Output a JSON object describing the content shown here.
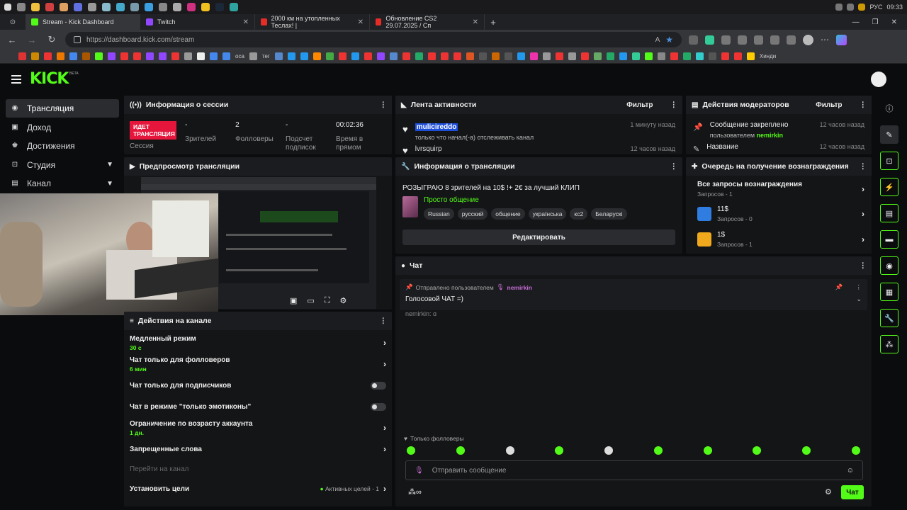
{
  "system": {
    "lang": "РУС",
    "time": "09:33"
  },
  "browser": {
    "tabs": [
      {
        "label": "Stream - Kick Dashboard",
        "color": "#53fc18"
      },
      {
        "label": "Twitch",
        "color": "#9146ff"
      },
      {
        "label": "2000 км на утопленных Теслах! |",
        "color": "#e52d27"
      },
      {
        "label": "Обновление CS2 29.07.2025 / Сп",
        "color": "#e52d27"
      }
    ],
    "url": "https://dashboard.kick.com/stream",
    "bookmarks": [
      "оса",
      "тег",
      "Хинди"
    ]
  },
  "brand": {
    "logo": "KICK",
    "beta": "BETA"
  },
  "sidebar": {
    "items": [
      {
        "label": "Трансляция",
        "icon": "broadcast-icon"
      },
      {
        "label": "Доход",
        "icon": "wallet-icon"
      },
      {
        "label": "Достижения",
        "icon": "trophy-icon"
      },
      {
        "label": "Студия",
        "icon": "studio-icon"
      },
      {
        "label": "Канал",
        "icon": "channel-icon"
      }
    ]
  },
  "session": {
    "title": "Информация о сессии",
    "badge": "ИДЕТ ТРАНСЛЯЦИЯ",
    "badge_label": "Сессия",
    "viewers_value": "-",
    "viewers_label": "Зрителей",
    "followers_value": "2",
    "followers_label": "Фолловеры",
    "subs_value": "-",
    "subs_label": "Подсчет подписок",
    "time_value": "00:02:36",
    "time_label": "Время в прямом"
  },
  "activity": {
    "title": "Лента активности",
    "filter": "Фильтр",
    "items": [
      {
        "name": "mulicireddo",
        "text": "только что начал(-а) отслеживать канал",
        "time": "1 минуту назад"
      },
      {
        "name": "lvrsquirp",
        "text": "",
        "time": "12 часов назад"
      }
    ]
  },
  "mod": {
    "title": "Действия модераторов",
    "filter": "Фильтр",
    "items": [
      {
        "title": "Сообщение закреплено",
        "by_prefix": "пользователем",
        "by": "nemirkin",
        "time": "12 часов назад"
      },
      {
        "title": "Название",
        "by_prefix": "",
        "by": "",
        "time": "12 часов назад"
      }
    ]
  },
  "preview": {
    "title": "Предпросмотр трансляции"
  },
  "stream_info": {
    "title": "Информация о трансляции",
    "stream_title": "РОЗЫГРАЮ 8 зрителей на 10$ !+ 2€ за лучший КЛИП",
    "category": "Просто общение",
    "tags": [
      "Russian",
      "русский",
      "общение",
      "українська",
      "кс2",
      "Беларускі"
    ],
    "edit": "Редактировать"
  },
  "rewards": {
    "title": "Очередь на получение вознаграждения",
    "items": [
      {
        "name": "Все запросы вознаграждения",
        "sub": "Запросов - 1",
        "color": ""
      },
      {
        "name": "11$",
        "sub": "Запросов - 0",
        "color": "#2f7de1"
      },
      {
        "name": "1$",
        "sub": "Запросов - 1",
        "color": "#f0a81c"
      }
    ]
  },
  "chat": {
    "title": "Чат",
    "pinned_prefix": "Отправлено пользователем",
    "pinned_user": "nemirkin",
    "pinned_msg": "Голосовой ЧАТ =)",
    "peek": "nemirkin: q",
    "followers_only": "Только фолловеры",
    "placeholder": "Отправить сообщение",
    "send": "Чат"
  },
  "channel_actions": {
    "title": "Действия на канале",
    "items": [
      {
        "label": "Медленный режим",
        "sub": "30 с",
        "control": "chevron"
      },
      {
        "label": "Чат только для фолловеров",
        "sub": "6 мин",
        "control": "chevron"
      },
      {
        "label": "Чат только для подписчиков",
        "sub": "",
        "control": "toggle"
      },
      {
        "label": "Чат в режиме \"только эмотиконы\"",
        "sub": "",
        "control": "toggle"
      },
      {
        "label": "Ограничение по возрасту аккаунта",
        "sub": "1 дн.",
        "control": "chevron"
      },
      {
        "label": "Запрещенные слова",
        "sub": "",
        "control": "chevron"
      },
      {
        "label": "Перейти на канал",
        "sub": "",
        "control": "none"
      },
      {
        "label": "Установить цели",
        "sub": "",
        "control": "goals"
      }
    ],
    "goals_text": "Активных целей - 1"
  }
}
